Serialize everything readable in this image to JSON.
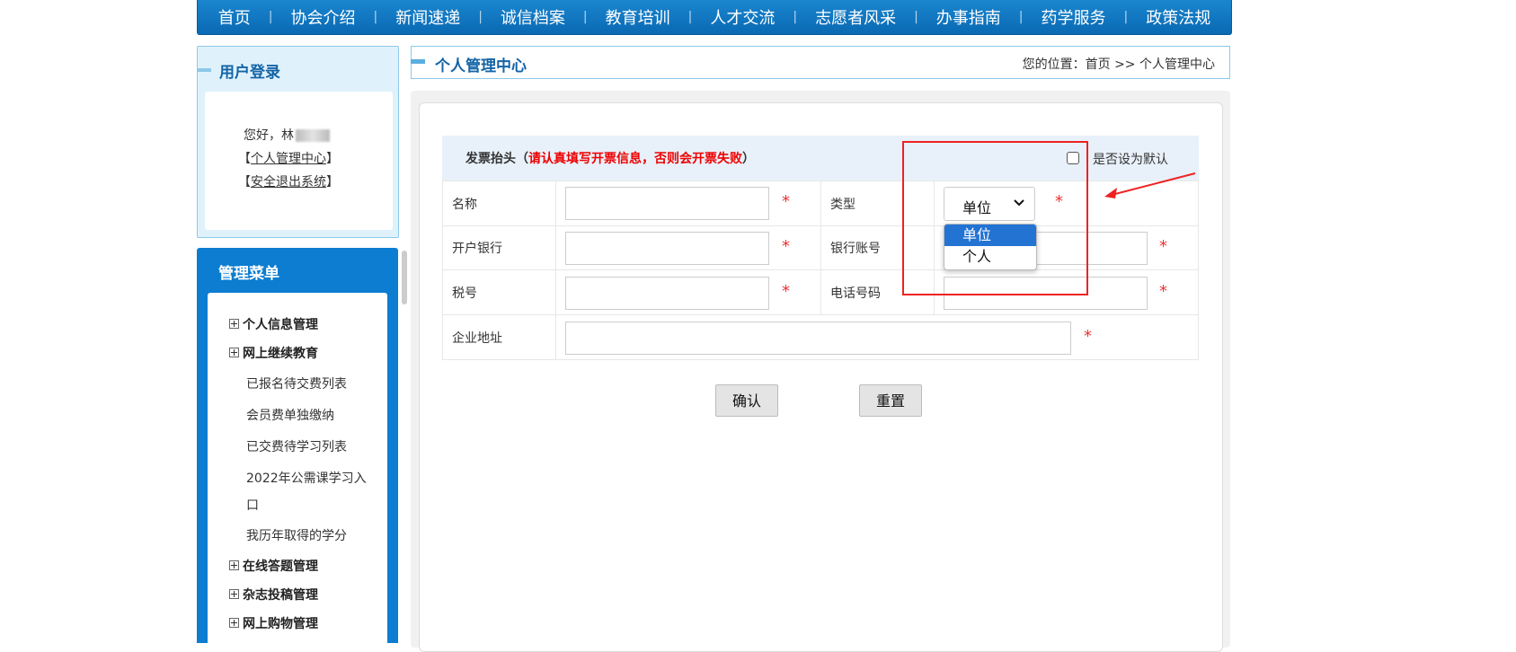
{
  "nav": [
    "首页",
    "协会介绍",
    "新闻速递",
    "诚信档案",
    "教育培训",
    "人才交流",
    "志愿者风采",
    "办事指南",
    "药学服务",
    "政策法规"
  ],
  "login": {
    "title": "用户登录",
    "greeting": "您好，林",
    "lb": "【",
    "rb": "】",
    "link_center": "个人管理中心",
    "link_logout": "安全退出系统"
  },
  "menu": {
    "title": "管理菜单",
    "items": {
      "personal_info": "个人信息管理",
      "online_edu": "网上继续教育",
      "pending_pay": "已报名待交费列表",
      "member_fee": "会员费单独缴纳",
      "paid_study": "已交费待学习列表",
      "public_course_1": "2022年公需课学习入",
      "public_course_2": "口",
      "credits": "我历年取得的学分",
      "online_quiz": "在线答题管理",
      "journal": "杂志投稿管理",
      "shopping": "网上购物管理"
    }
  },
  "header": {
    "title": "个人管理中心",
    "crumb_prefix": "您的位置：",
    "crumb_home": "首页",
    "crumb_sep": " >> ",
    "crumb_current": "个人管理中心"
  },
  "invoice": {
    "title": "发票抬头（",
    "warning": "请认真填写开票信息，否则会开票失败",
    "title_end": "）",
    "default_label": "是否设为默认",
    "star": "*",
    "fields": {
      "name": "名称",
      "type": "类型",
      "bank": "开户银行",
      "account": "银行账号",
      "tax": "税号",
      "phone": "电话号码",
      "address": "企业地址"
    },
    "type_selected": "单位",
    "type_options": [
      "单位",
      "个人"
    ],
    "confirm": "确认",
    "reset": "重置"
  }
}
